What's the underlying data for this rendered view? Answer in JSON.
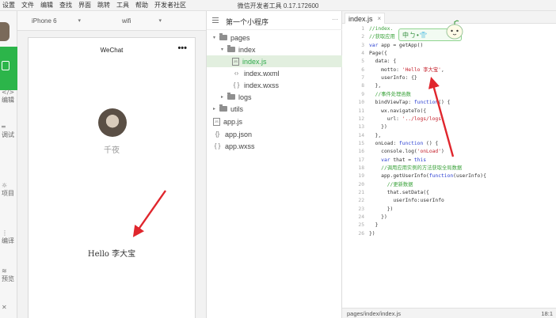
{
  "menubar": {
    "items": [
      "设置",
      "文件",
      "编辑",
      "查找",
      "界面",
      "跳转",
      "工具",
      "帮助",
      "开发者社区"
    ],
    "title": "微信开发者工具 0.17.172600"
  },
  "toolbar": {
    "items": [
      {
        "glyph": "</>",
        "label": "编辑"
      },
      {
        "glyph": "═",
        "label": "调试"
      },
      {
        "glyph": "☼",
        "label": "项目"
      },
      {
        "glyph": "⋮",
        "label": "编译"
      },
      {
        "glyph": "≋",
        "label": "预览"
      },
      {
        "glyph": "✕",
        "label": ""
      }
    ]
  },
  "simulator": {
    "device": "iPhone 6",
    "network": "wifi",
    "nav_title": "WeChat",
    "nav_more": "•••",
    "nickname": "千夜",
    "motto": "Hello 李大宝"
  },
  "tree": {
    "project": "第一个小程序",
    "more": "···",
    "nodes": [
      {
        "name": "pages",
        "type": "folder",
        "arrow": "▾"
      },
      {
        "name": "index",
        "type": "folder",
        "arrow": "▾"
      },
      {
        "name": "index.js",
        "type": "js",
        "icon": "JS"
      },
      {
        "name": "index.wxml",
        "type": "wxml",
        "icon": "‹›"
      },
      {
        "name": "index.wxss",
        "type": "wxss",
        "icon": "{ }"
      },
      {
        "name": "logs",
        "type": "folder",
        "arrow": "▸"
      },
      {
        "name": "utils",
        "type": "folder",
        "arrow": "▸"
      },
      {
        "name": "app.js",
        "type": "js",
        "icon": "JS"
      },
      {
        "name": "app.json",
        "type": "json",
        "icon": "{}"
      },
      {
        "name": "app.wxss",
        "type": "wxss",
        "icon": "{ }"
      }
    ]
  },
  "editor": {
    "tab": "index.js",
    "tab_close": "×",
    "ime_text": "中ㄅ•👕",
    "lines": [
      [
        {
          "t": "//index.",
          "c": "com"
        }
      ],
      [
        {
          "t": "//获取应用",
          "c": "com"
        }
      ],
      [
        {
          "t": "var",
          "c": "kw"
        },
        {
          "t": " app = getApp()",
          "c": "txt"
        }
      ],
      [
        {
          "t": "Page({",
          "c": "txt"
        }
      ],
      [
        {
          "t": "  data: {",
          "c": "txt"
        }
      ],
      [
        {
          "t": "    motto: ",
          "c": "txt"
        },
        {
          "t": "'Hello 李大宝'",
          "c": "str"
        },
        {
          "t": ",",
          "c": "txt"
        }
      ],
      [
        {
          "t": "    userInfo: {}",
          "c": "txt"
        }
      ],
      [
        {
          "t": "  },",
          "c": "txt"
        }
      ],
      [
        {
          "t": "  //事件处理函数",
          "c": "com"
        }
      ],
      [
        {
          "t": "  bindViewTap: ",
          "c": "txt"
        },
        {
          "t": "function",
          "c": "kw"
        },
        {
          "t": "() {",
          "c": "txt"
        }
      ],
      [
        {
          "t": "    wx.navigateTo({",
          "c": "txt"
        }
      ],
      [
        {
          "t": "      url: ",
          "c": "txt"
        },
        {
          "t": "'../logs/logs'",
          "c": "str"
        }
      ],
      [
        {
          "t": "    })",
          "c": "txt"
        }
      ],
      [
        {
          "t": "  },",
          "c": "txt"
        }
      ],
      [
        {
          "t": "  onLoad: ",
          "c": "txt"
        },
        {
          "t": "function",
          "c": "kw"
        },
        {
          "t": " () {",
          "c": "txt"
        }
      ],
      [
        {
          "t": "    console.log(",
          "c": "txt"
        },
        {
          "t": "'onLoad'",
          "c": "str"
        },
        {
          "t": ")",
          "c": "txt"
        }
      ],
      [
        {
          "t": "    ",
          "c": "txt"
        },
        {
          "t": "var",
          "c": "kw"
        },
        {
          "t": " that = ",
          "c": "txt"
        },
        {
          "t": "this",
          "c": "kw"
        }
      ],
      [
        {
          "t": "    //调用应用实例的方法获取全局数据",
          "c": "com"
        }
      ],
      [
        {
          "t": "    app.getUserInfo(",
          "c": "txt"
        },
        {
          "t": "function",
          "c": "kw"
        },
        {
          "t": "(userInfo){",
          "c": "txt"
        }
      ],
      [
        {
          "t": "      //更新数据",
          "c": "com"
        }
      ],
      [
        {
          "t": "      that.setData({",
          "c": "txt"
        }
      ],
      [
        {
          "t": "        userInfo:userInfo",
          "c": "txt"
        }
      ],
      [
        {
          "t": "      })",
          "c": "txt"
        }
      ],
      [
        {
          "t": "    })",
          "c": "txt"
        }
      ],
      [
        {
          "t": "  }",
          "c": "txt"
        }
      ],
      [
        {
          "t": "})",
          "c": "txt"
        }
      ]
    ],
    "status_path": "pages/index/index.js",
    "status_pos": "18:1"
  },
  "colors": {
    "accent": "#2cb54a",
    "arrow": "#e0262d",
    "keyword": "#2b3fd1",
    "string": "#c4202b",
    "comment": "#3aa23a"
  }
}
